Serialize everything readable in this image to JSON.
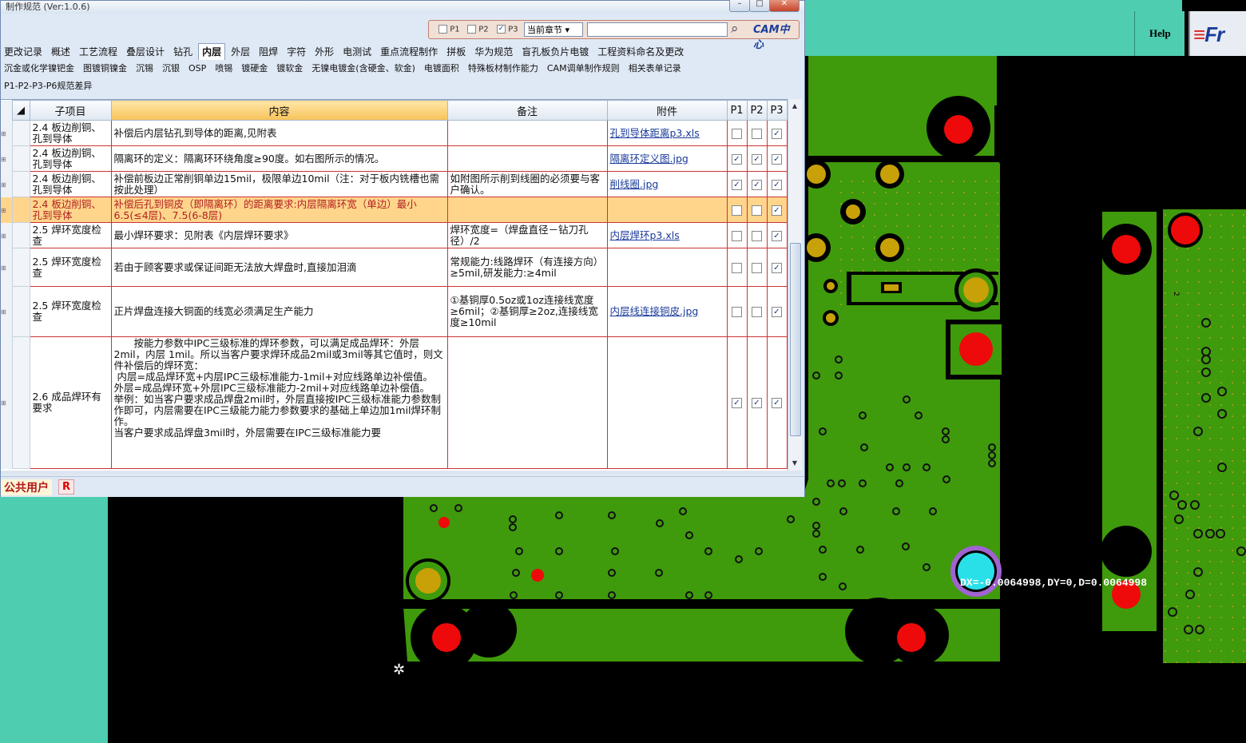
{
  "window": {
    "title": "制作规范 (Ver:1.0.6)"
  },
  "app_header": {
    "help_label": "Help",
    "logo_text": "Fr"
  },
  "filter": {
    "p1_label": "P1",
    "p1_checked": false,
    "p2_label": "P2",
    "p2_checked": false,
    "p3_label": "P3",
    "p3_checked": true,
    "section_select": "当前章节",
    "search_value": "",
    "cam_logo": "CAM中心"
  },
  "tabs_row1": [
    "更改记录",
    "概述",
    "工艺流程",
    "叠层设计",
    "钻孔",
    "内层",
    "外层",
    "阻焊",
    "字符",
    "外形",
    "电测试",
    "重点流程制作",
    "拼板",
    "华为规范",
    "盲孔板负片电镀",
    "工程资料命名及更改"
  ],
  "active_tab": "内层",
  "tabs_row2": [
    "沉金或化学镍钯金",
    "图镀铜镍金",
    "沉锡",
    "沉银",
    "OSP",
    "喷锡",
    "镀硬金",
    "镀软金",
    "无镍电镀金(含硬金、软金)",
    "电镀面积",
    "特殊板材制作能力",
    "CAM调单制作规则",
    "相关表单记录"
  ],
  "tabs_row3": [
    "P1-P2-P3-P6规范差异"
  ],
  "table": {
    "headers": [
      "子项目",
      "内容",
      "备注",
      "附件",
      "P1",
      "P2",
      "P3"
    ],
    "rows": [
      {
        "sub": "2.4 板边削铜、孔到导体",
        "content": "补偿后内层钻孔到导体的距离,见附表",
        "note": "",
        "attach": "孔到导体距离p3.xls",
        "p1": false,
        "p2": false,
        "p3": true
      },
      {
        "sub": "2.4 板边削铜、孔到导体",
        "content": "隔离环的定义：隔离环环绕角度≥90度。如右图所示的情况。",
        "note": "",
        "attach": "隔离环定义图.jpg",
        "p1": true,
        "p2": true,
        "p3": true
      },
      {
        "sub": "2.4 板边削铜、孔到导体",
        "content": "补偿前板边正常削铜单边15mil，极限单边10mil（注：对于板内铣槽也需按此处理）",
        "note": "如附图所示削到线圈的必须要与客户确认。",
        "attach": "削线圈.jpg",
        "p1": true,
        "p2": true,
        "p3": true
      },
      {
        "sub": "2.4 板边削铜、孔到导体",
        "content": "补偿后孔到铜皮（即隔离环）的距离要求:内层隔离环宽（单边）最小6.5(≤4层)、7.5(6-8层)",
        "note": "",
        "attach": "",
        "p1": false,
        "p2": false,
        "p3": true,
        "highlight": true
      },
      {
        "sub": "2.5 焊环宽度检查",
        "content": "最小焊环要求：见附表《内层焊环要求》",
        "note": "焊环宽度=（焊盘直径－钻刀孔径）/2",
        "attach": "内层焊环p3.xls",
        "p1": false,
        "p2": false,
        "p3": true
      },
      {
        "sub": "2.5 焊环宽度检查",
        "content": "若由于顾客要求或保证间距无法放大焊盘时,直接加泪滴",
        "note": "常规能力:线路焊环（有连接方向）≥5mil,研发能力:≥4mil",
        "attach": "",
        "p1": false,
        "p2": false,
        "p3": true
      },
      {
        "sub": "2.5 焊环宽度检查",
        "content": "正片焊盘连接大铜面的线宽必须满足生产能力",
        "note": "①基铜厚0.5oz或1oz连接线宽度≥6mil；②基铜厚≥2oz,连接线宽度≥10mil",
        "attach": "内层线连接铜皮.jpg",
        "p1": false,
        "p2": false,
        "p3": true
      },
      {
        "sub": "2.6 成品焊环有要求",
        "content": "　　按能力参数中IPC三级标准的焊环参数，可以满足成品焊环：外层2mil，内层 1mil。所以当客户要求焊环成品2mil或3mil等其它值时，则文件补偿后的焊环宽：\n 内层=成品焊环宽+内层IPC三级标准能力-1mil+对应线路单边补偿值。\n外层=成品焊环宽+外层IPC三级标准能力-2mil+对应线路单边补偿值。\n举例：如当客户要求成品焊盘2mil时，外层直接按IPC三级标准能力参数制作即可，内层需要在IPC三级能力能力参数要求的基础上单边加1mil焊环制作。\n当客户要求成品焊盘3mil时，外层需要在IPC三级标准能力要",
        "note": "",
        "attach": "",
        "p1": true,
        "p2": true,
        "p3": true
      }
    ]
  },
  "status": {
    "user": "公共用户",
    "badge": "R"
  },
  "measure_readout": "DX=-0.0064998,DY=0,D=0.0064998",
  "colors": {
    "teal": "#4fcdb0",
    "pcb_green": "#3f9a0c",
    "pad_red": "#ee0a0a",
    "pad_gold": "#c8a008",
    "highlight": "#ffd58c"
  }
}
